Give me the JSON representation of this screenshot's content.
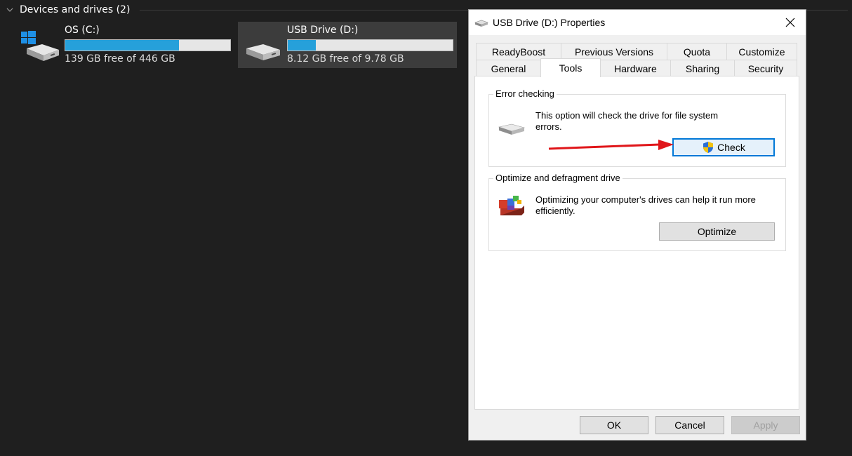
{
  "explorer": {
    "section_title": "Devices and drives (2)",
    "drives": [
      {
        "name": "OS (C:)",
        "free_text": "139 GB free of 446 GB",
        "used_fraction": 0.69
      },
      {
        "name": "USB Drive (D:)",
        "free_text": "8.12 GB free of 9.78 GB",
        "used_fraction": 0.17
      }
    ]
  },
  "dialog": {
    "title": "USB Drive (D:) Properties",
    "tabs_row1": [
      "ReadyBoost",
      "Previous Versions",
      "Quota",
      "Customize"
    ],
    "tabs_row2": [
      "General",
      "Tools",
      "Hardware",
      "Sharing",
      "Security"
    ],
    "active_tab": "Tools",
    "error_checking": {
      "legend": "Error checking",
      "description": "This option will check the drive for file system errors.",
      "button": "Check"
    },
    "optimize": {
      "legend": "Optimize and defragment drive",
      "description": "Optimizing your computer's drives can help it run more efficiently.",
      "button": "Optimize"
    },
    "footer": {
      "ok": "OK",
      "cancel": "Cancel",
      "apply": "Apply"
    }
  },
  "colors": {
    "accent": "#26a0da",
    "focus": "#0078d7",
    "annotation_arrow": "#e0161a"
  }
}
